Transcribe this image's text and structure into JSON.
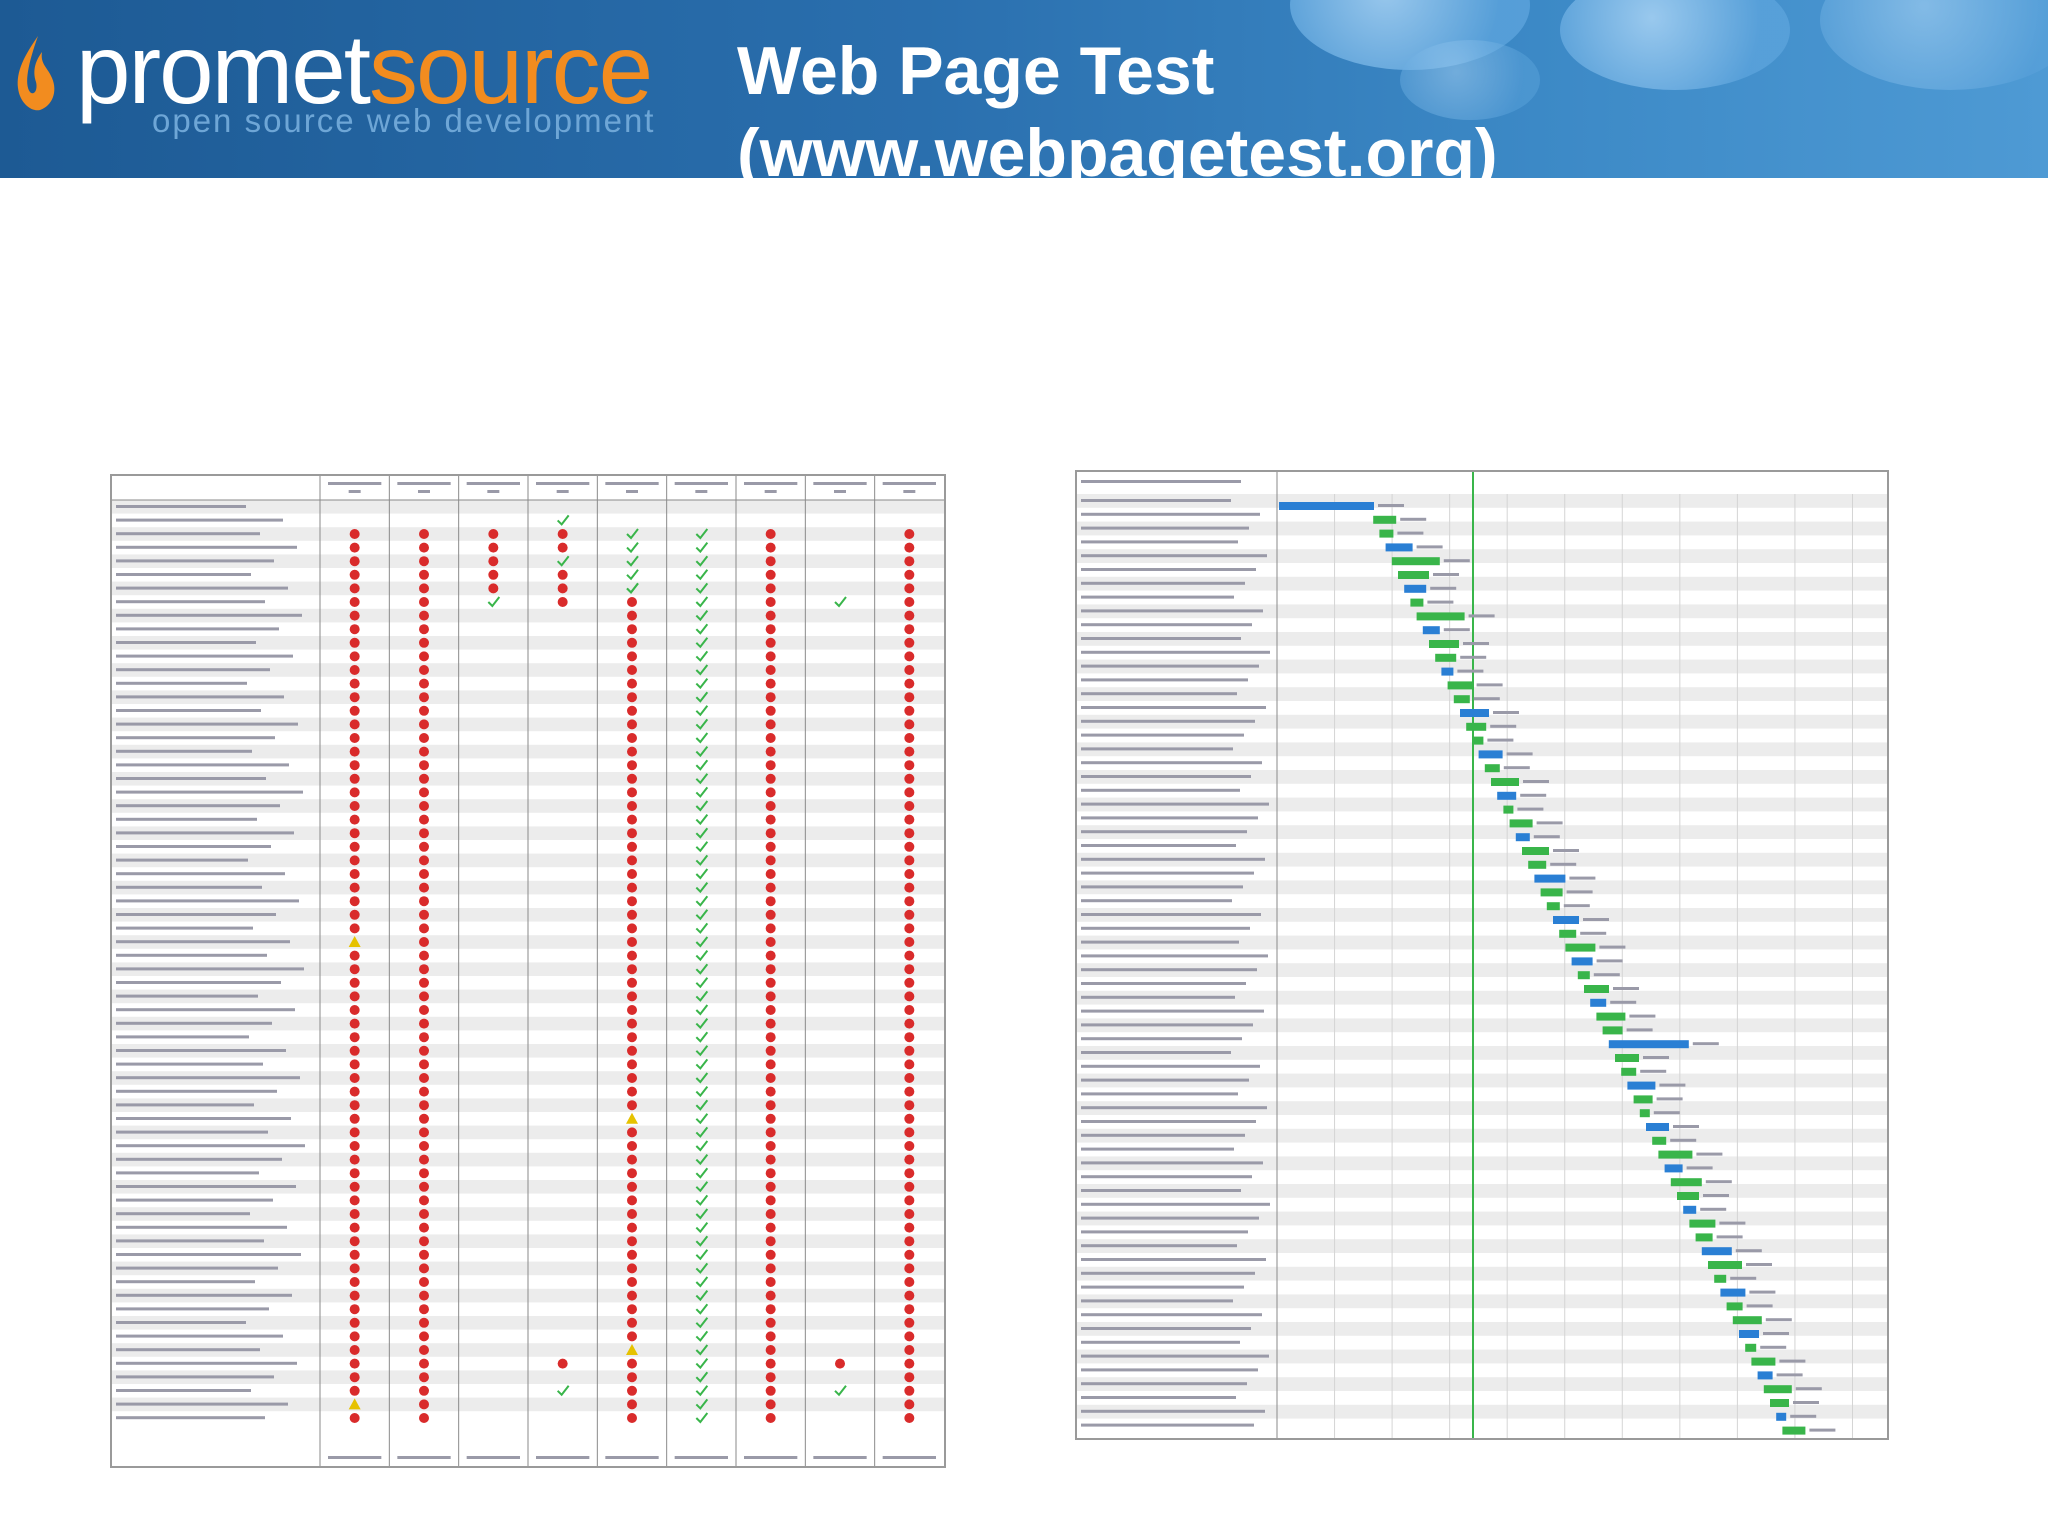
{
  "brand": {
    "name_part1": "promet",
    "name_part2": "source",
    "tagline": "open source web development",
    "colors": {
      "header_blue": "#2a6fae",
      "accent_orange": "#f28c1f"
    },
    "icon": "flame-icon"
  },
  "slide": {
    "title_line1": "Web Page Test",
    "title_line2": "(www.webpagetest.org)"
  },
  "optimization_grid": {
    "row_count": 68,
    "column_count": 9,
    "legend": {
      "fail": "red-circle-icon",
      "warning": "yellow-triangle-icon",
      "pass": "green-check-icon"
    },
    "colors": {
      "fail": "#d92b2b",
      "warning": "#e6c200",
      "pass": "#39b54a"
    }
  },
  "waterfall": {
    "row_count": 68,
    "start_render_marker_color": "#39b54a",
    "colors": {
      "download": "#39b54a",
      "connect": "#2a7fd4"
    }
  }
}
